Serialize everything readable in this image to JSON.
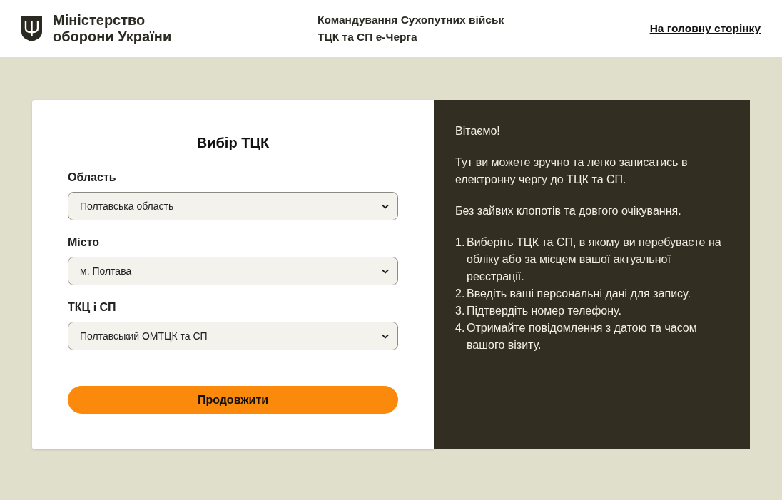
{
  "header": {
    "logo_lines": [
      "Міністерство",
      "оборони України"
    ],
    "center_lines": [
      "Командування Сухопутних військ",
      "ТЦК та СП е-Черга"
    ],
    "home_link": "На головну сторінку"
  },
  "form": {
    "title": "Вибір ТЦК",
    "fields": [
      {
        "label": "Область",
        "value": "Полтавська область"
      },
      {
        "label": "Місто",
        "value": "м. Полтава"
      },
      {
        "label": "ТКЦ і СП",
        "value": "Полтавський ОМТЦК та СП"
      }
    ],
    "submit": "Продовжити"
  },
  "info": {
    "greeting": "Вітаємо!",
    "paragraphs": [
      "Тут ви можете зручно та легко записатись в електронну чергу до ТЦК та СП.",
      "Без зайвих клопотів та довгого очікування."
    ],
    "steps": [
      {
        "number": "1.",
        "text": "Виберіть ТЦК та СП, в якому ви перебуваєте на обліку або за місцем вашої актуальної реєстрації."
      },
      {
        "number": "2.",
        "text": "Введіть ваші персональні дані для запису."
      },
      {
        "number": "3.",
        "text": "Підтвердіть номер телефону."
      },
      {
        "number": "4.",
        "text": "Отримайте повідомлення з датою та часом вашого візиту."
      }
    ]
  }
}
